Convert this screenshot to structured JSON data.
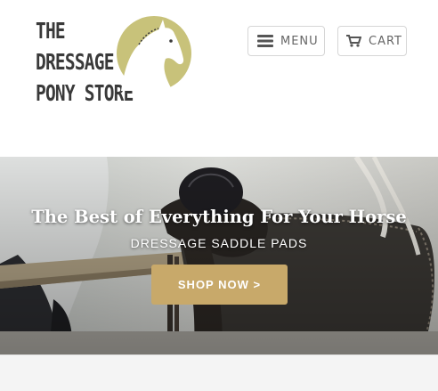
{
  "logo": {
    "line1": "THE",
    "line2": "DRESSAGE",
    "line3": "PONY STORE",
    "brand_color": "#c8c27a"
  },
  "header": {
    "menu_label": "MENU",
    "cart_label": "CART",
    "menu_icon": "hamburger-icon",
    "cart_icon": "cart-icon"
  },
  "hero": {
    "title": "The Best of Everything For Your Horse",
    "subtitle": "DRESSAGE SADDLE PADS",
    "cta_label": "SHOP NOW >",
    "cta_color": "#c8a96a"
  }
}
